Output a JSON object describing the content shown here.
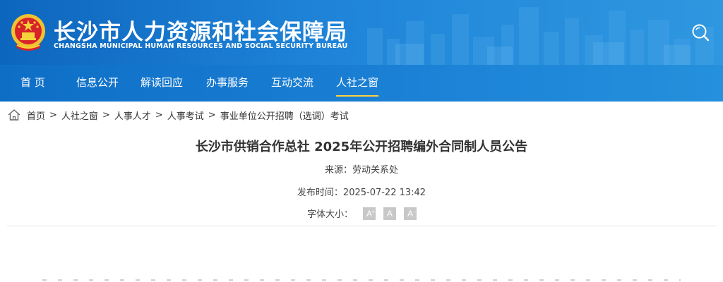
{
  "header": {
    "title_cn": "长沙市人力资源和社会保障局",
    "title_en": "CHANGSHA MUNICIPAL HUMAN RESOURCES AND SOCIAL SECURITY BUREAU",
    "emblem_icon": "national-emblem-icon",
    "search_icon": "search-icon"
  },
  "nav": {
    "items": [
      {
        "label": "首 页"
      },
      {
        "label": "信息公开"
      },
      {
        "label": "解读回应"
      },
      {
        "label": "办事服务"
      },
      {
        "label": "互动交流"
      },
      {
        "label": "人社之窗"
      }
    ],
    "active_index": 5
  },
  "breadcrumb": {
    "home_icon": "home-icon",
    "items": [
      {
        "label": "首页"
      },
      {
        "label": "人社之窗"
      },
      {
        "label": "人事人才"
      },
      {
        "label": "人事考试"
      },
      {
        "label": "事业单位公开招聘（选调）考试"
      }
    ],
    "separator": ">"
  },
  "article": {
    "title": "长沙市供销合作总社 2025年公开招聘编外合同制人员公告",
    "source": "来源：劳动关系处",
    "publish_time": "发布时间：2025-07-22 13:42",
    "fontsize_label": "字体大小：",
    "fontsize_buttons": [
      {
        "label": "A",
        "mark": "+"
      },
      {
        "label": "A",
        "mark": ""
      },
      {
        "label": "A",
        "mark": "-"
      }
    ]
  },
  "colors": {
    "header_blue": "#1470c8",
    "nav_active_underline": "#ffd040",
    "text": "#333333"
  }
}
